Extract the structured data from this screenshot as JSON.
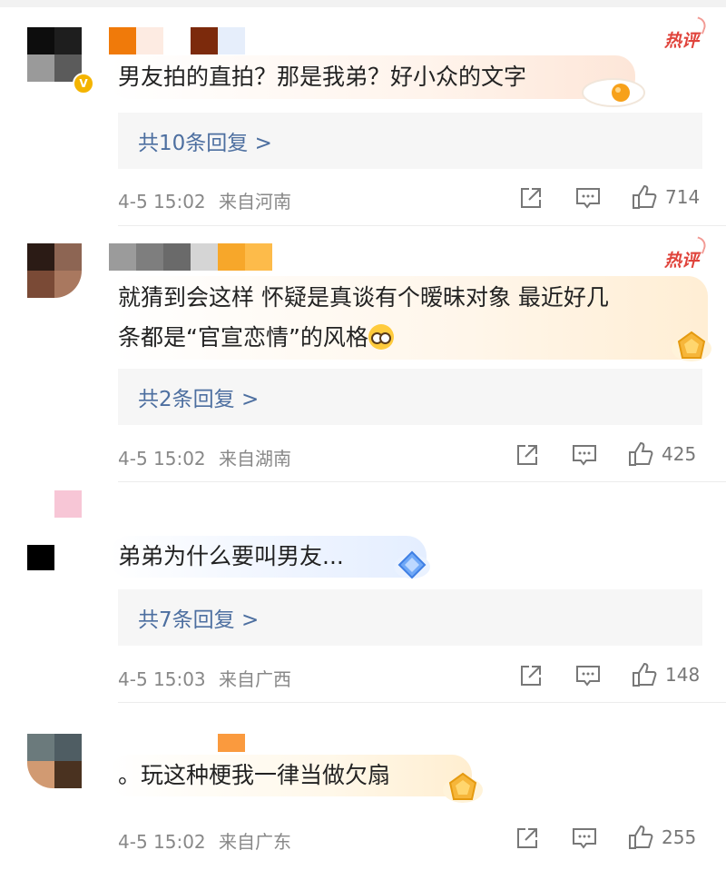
{
  "comments": [
    {
      "hot_label": "热评",
      "text": "男友拍的直拍？那是我弟？好小众的文字",
      "replies_label": "共10条回复 >",
      "time": "4-5 15:02",
      "location": "来自河南",
      "likes": "714",
      "verified": true,
      "sticker": "egg-sticker"
    },
    {
      "hot_label": "热评",
      "text_line1": "就猜到会这样 怀疑是真谈有个暧昧对象 最近好几",
      "text_line2": "条都是“官宣恋情”的风格",
      "emoji": "nerd-face-emoji",
      "replies_label": "共2条回复 >",
      "time": "4-5 15:02",
      "location": "来自湖南",
      "likes": "425",
      "sticker": "gold-badge-sticker"
    },
    {
      "text": "弟弟为什么要叫男友...",
      "replies_label": "共7条回复 >",
      "time": "4-5 15:03",
      "location": "来自广西",
      "likes": "148",
      "sticker": "blue-diamond-sticker"
    },
    {
      "text": "。玩这种梗我一律当做欠扇",
      "time": "4-5 15:02",
      "location": "来自广东",
      "likes": "255",
      "sticker": "gold-badge-sticker"
    }
  ],
  "icons": {
    "share": "share-icon",
    "comment": "comment-icon",
    "like": "thumbs-up-icon"
  },
  "colors": {
    "hot": "#e0443c",
    "reply_link": "#4d6fa0",
    "meta": "#888888",
    "verified": "#f4b400"
  }
}
